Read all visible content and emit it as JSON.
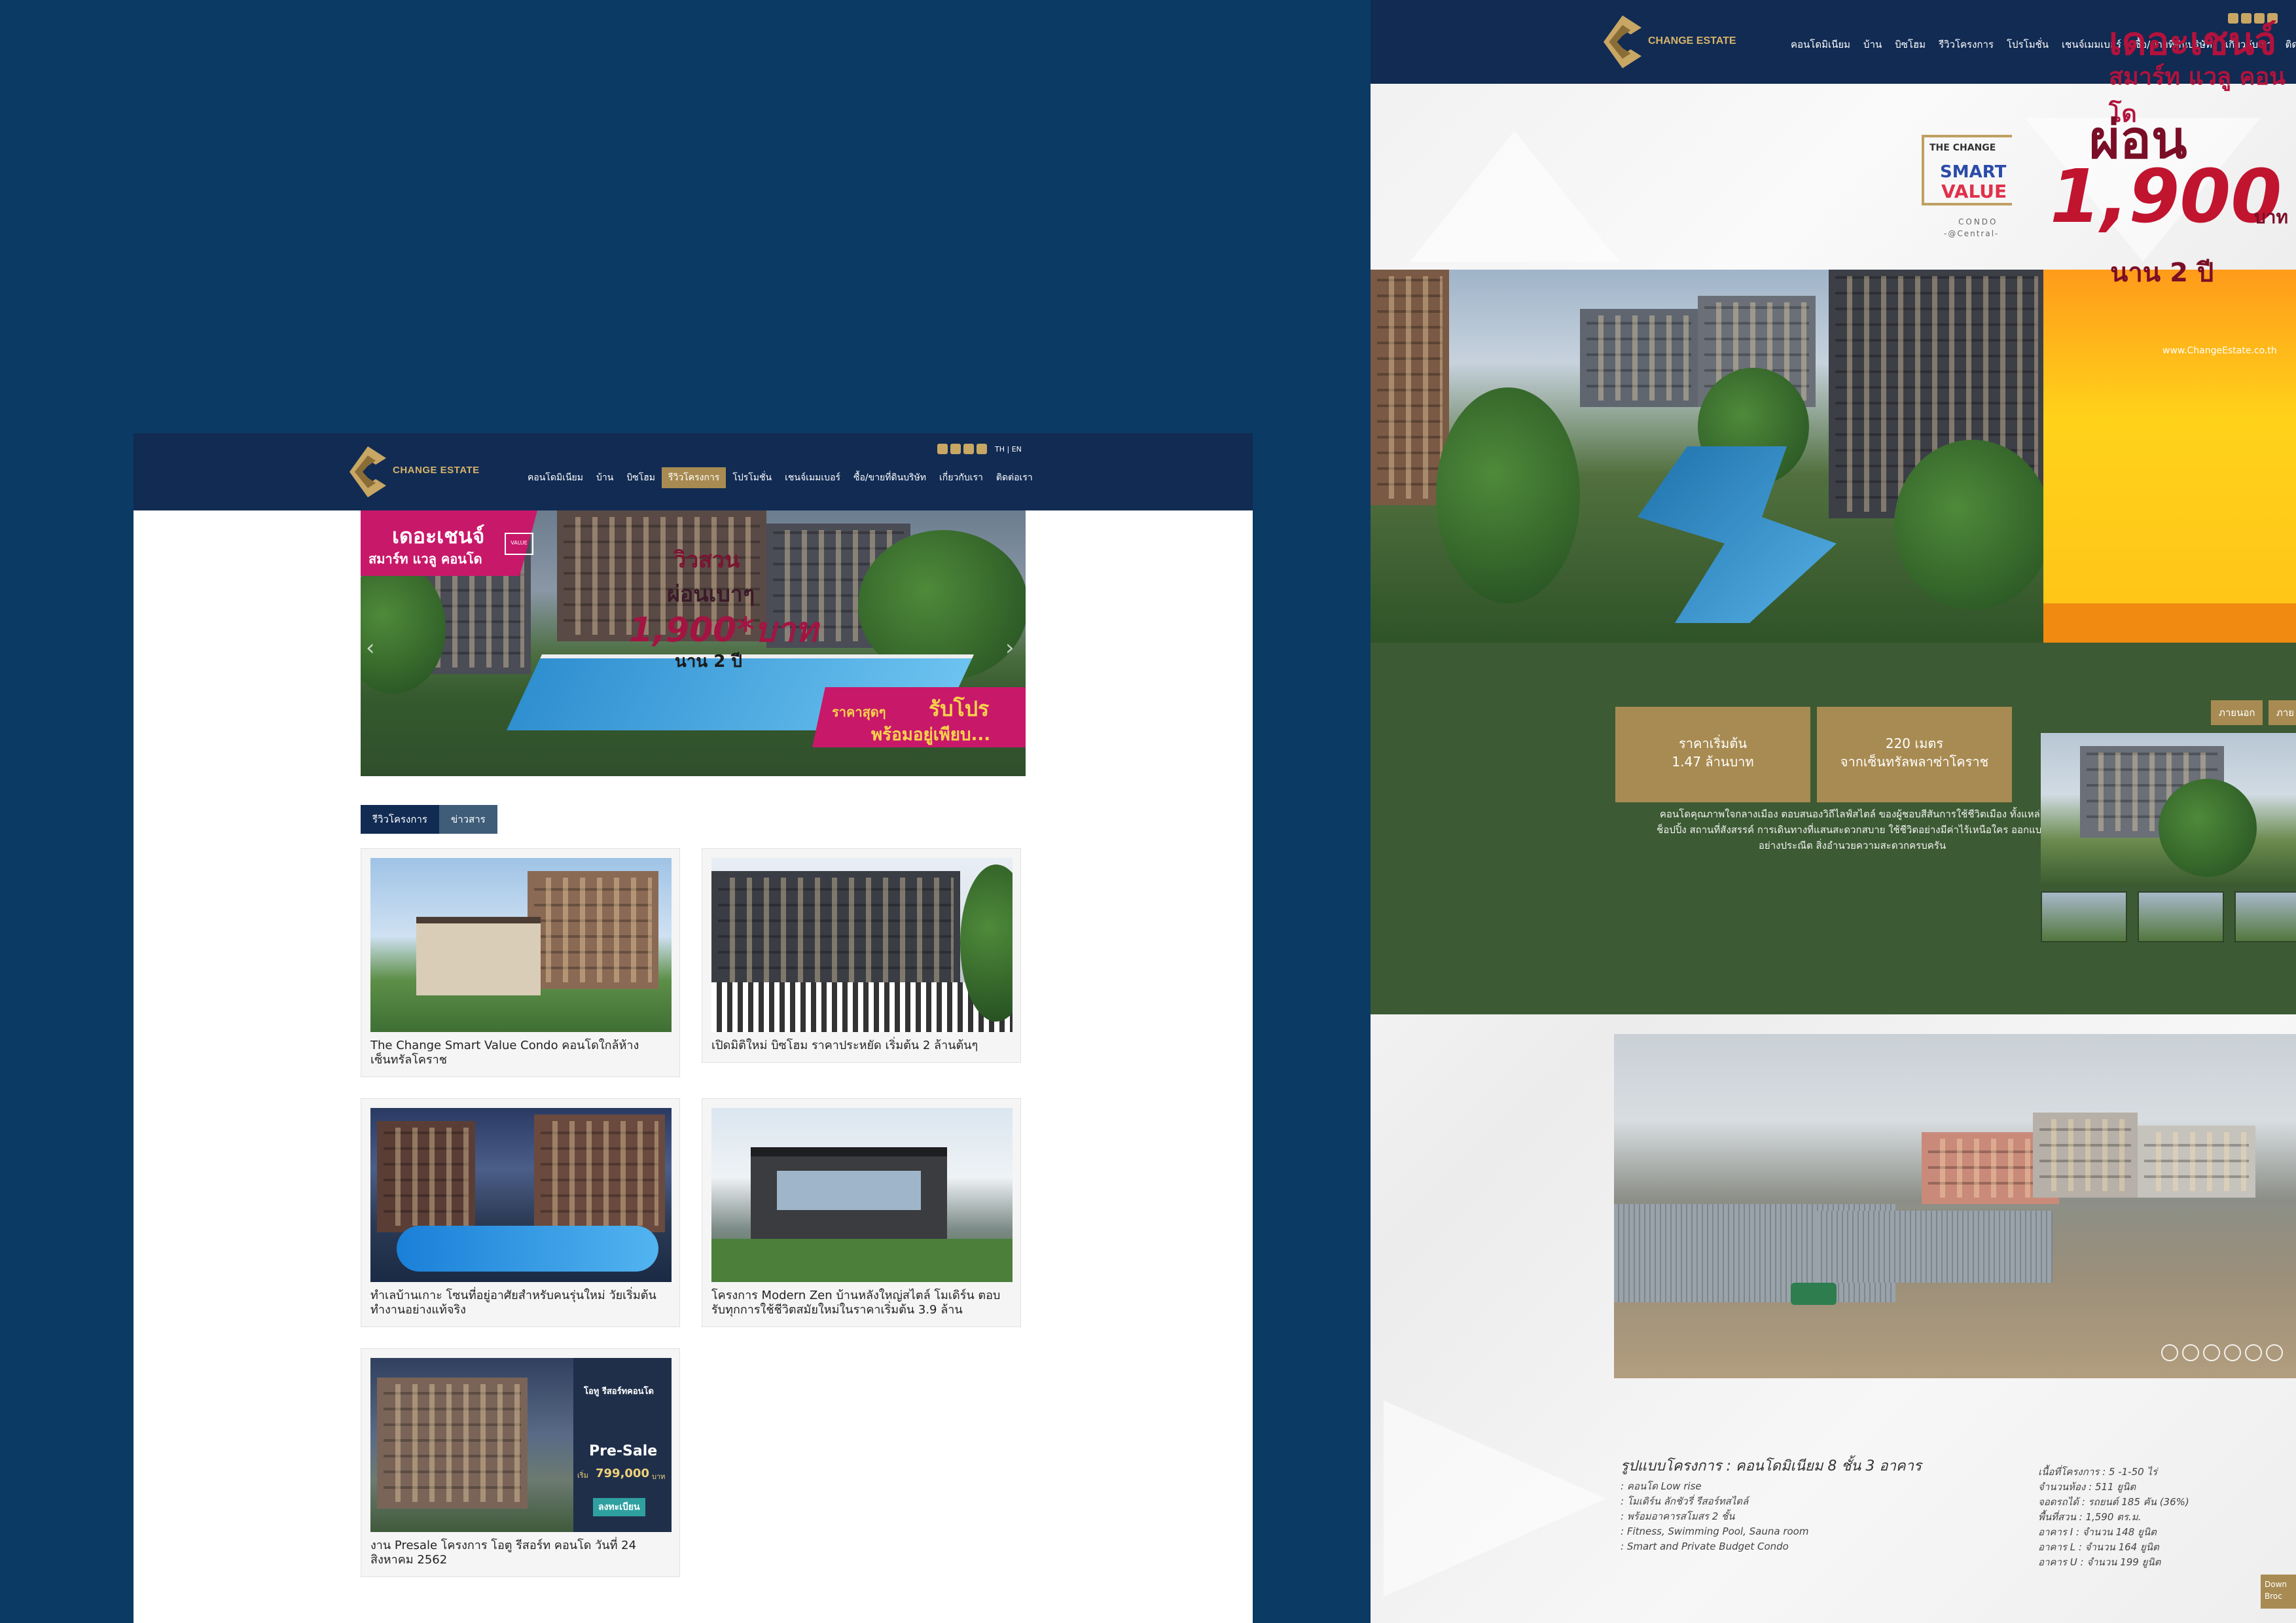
{
  "brand": {
    "name": "CHANGE ESTATE",
    "accent": "#a88b52",
    "navy": "#112b53",
    "background": "#0b3a64"
  },
  "left_page": {
    "nav": [
      "คอนโดมิเนียม",
      "บ้าน",
      "บิซโฮม",
      "รีวิวโครงการ",
      "โปรโมชั่น",
      "เชนจ์เมมเบอร์",
      "ซื้อ/ขายที่ดินบริษัท",
      "เกี่ยวกับเรา",
      "ติดต่อเรา"
    ],
    "nav_active_index": 3,
    "lang": "TH | EN",
    "social_icons": [
      "facebook-icon",
      "line-icon",
      "youtube-icon",
      "instagram-icon"
    ],
    "banner": {
      "tag_line1": "เดอะเชนจ์",
      "tag_line2": "สมาร์ท แวลู คอนโด",
      "tag_badge": "VALUE",
      "headline1": "วิวสวน",
      "headline2": "ผ่อนเบาๆ",
      "price": "1,900*บาท",
      "duration": "นาน 2 ปี",
      "cta_small": "ราคาสุดๆ",
      "cta_big": "รับโปร",
      "cta_line2": "พร้อมอยู่เพียบ..."
    },
    "tabs": [
      "รีวิวโครงการ",
      "ข่าวสาร"
    ],
    "cards": [
      {
        "caption": "The Change Smart Value Condo คอนโดใกล้ห้างเซ็นทรัลโคราช"
      },
      {
        "caption": "เปิดมิติใหม่ บิซโฮม ราคาประหยัด เริ่มต้น 2 ล้านต้นๆ"
      },
      {
        "caption": "ทำเลบ้านเกาะ โซนที่อยู่อาศัยสำหรับคนรุ่นใหม่ วัยเริ่มต้นทำงานอย่างแท้จริง"
      },
      {
        "caption": "โครงการ Modern Zen บ้านหลังใหญ่สไตล์ โมเดิร์น ตอบรับทุกการใช้ชีวิตสมัยใหม่ในราคาเริ่มต้น 3.9 ล้าน"
      },
      {
        "caption": "งาน Presale โครงการ โอตู รีสอร์ท คอนโด วันที่ 24 สิงหาคม 2562",
        "poster": {
          "brand": "โอทู รีสอร์ทคอนโด",
          "label": "Pre-Sale",
          "price_prefix": "เริ่ม",
          "price": "799,000",
          "unit": "บาท",
          "cta": "ลงทะเบียน"
        }
      }
    ]
  },
  "right_page": {
    "nav": [
      "คอนโดมิเนียม",
      "บ้าน",
      "บิซโฮม",
      "รีวิวโครงการ",
      "โปรโมชั่น",
      "เชนจ์เมมเบอร์",
      "ซื้อ/ขายที่ดินบริษัท",
      "เกี่ยวกับเรา",
      "ติด"
    ],
    "project_logo": {
      "the": "THE CHANGE",
      "smart": "SMART",
      "value": "VALUE",
      "condo": "CONDO",
      "location": "-@Central-"
    },
    "promo": {
      "line1": "เดอะเชนจ์",
      "line2": "สมาร์ท แวลู คอนโด",
      "line3": "ผ่อน",
      "price": "1,900",
      "unit": "บาท",
      "duration": "นาน 2 ปี",
      "site": "www.ChangeEstate.co.th"
    },
    "info_boxes": [
      {
        "line1": "ราคาเริ่มต้น",
        "line2": "1.47 ล้านบาท"
      },
      {
        "line1": "220 เมตร",
        "line2": "จากเซ็นทรัลพลาซ่าโคราช"
      }
    ],
    "description": "คอนโดคุณภาพใจกลางเมือง ตอบสนองวิถีไลฟ์สไตล์ ของผู้ชอบสีสันการใช้ชีวิตเมือง ทั้งแหล่งช็อปปิ้ง สถานที่สังสรรค์ การเดินทางที่แสนสะดวกสบาย ใช้ชีวิตอย่างมีค่าไร้เหนือใคร ออกแบบอย่างประณีต สิ่งอำนวยความสะดวกครบครัน",
    "gallery_tabs": [
      "ภายนอก",
      "ภาย"
    ],
    "spec": {
      "title": "รูปแบบโครงการ : คอนโดมิเนียม 8 ชั้น 3 อาคาร",
      "left_items": [
        ": คอนโด Low rise",
        ": โมเดิร์น ลักชัวรี่ รีสอร์ทสไตล์",
        ": พร้อมอาคารสโมสร 2 ชั้น",
        ": Fitness, Swimming Pool, Sauna room",
        ": Smart and Private Budget Condo"
      ],
      "right_items": [
        "เนื้อที่โครงการ : 5 -1-50 ไร่",
        "จำนวนห้อง : 511 ยูนิต",
        "จอดรถได้ : รถยนต์ 185 คัน (36%)",
        "พื้นที่สวน : 1,590 ตร.ม.",
        "อาคาร I : จำนวน 148 ยูนิต",
        "อาคาร L : จำนวน 164 ยูนิต",
        "อาคาร U : จำนวน 199 ยูนิต"
      ]
    },
    "download": "Down Broc"
  }
}
